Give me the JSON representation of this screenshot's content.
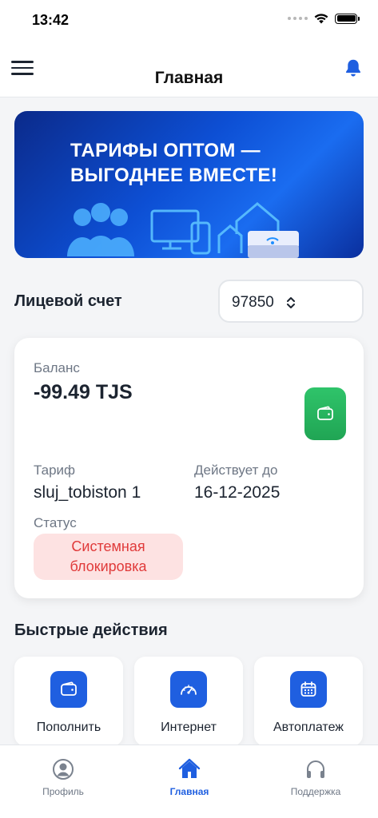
{
  "status_bar": {
    "time": "13:42"
  },
  "header": {
    "title": "Главная"
  },
  "banner": {
    "line1": "ТАРИФЫ ОПТОМ —",
    "line2": "ВЫГОДНЕЕ ВМЕСТЕ!"
  },
  "account": {
    "label": "Лицевой счет",
    "selected": "97850"
  },
  "card": {
    "balance_label": "Баланс",
    "balance_value": "-99.49 TJS",
    "tariff_label": "Тариф",
    "tariff_value": "sluj_tobiston 1",
    "valid_label": "Действует до",
    "valid_value": "16-12-2025",
    "status_label": "Статус",
    "status_value": "Системная блокировка"
  },
  "quick_actions": {
    "title": "Быстрые действия",
    "items": [
      {
        "label": "Пополнить",
        "icon": "wallet-icon"
      },
      {
        "label": "Интернет",
        "icon": "speedometer-icon"
      },
      {
        "label": "Автоплатеж",
        "icon": "calendar-icon"
      }
    ]
  },
  "tabs": [
    {
      "label": "Профиль",
      "icon": "profile-icon",
      "active": false
    },
    {
      "label": "Главная",
      "icon": "home-icon",
      "active": true
    },
    {
      "label": "Поддержка",
      "icon": "headset-icon",
      "active": false
    }
  ],
  "colors": {
    "accent": "#1f5fe0",
    "success": "#2fc46a",
    "danger": "#e03a3a",
    "danger_bg": "#fde2e2"
  }
}
